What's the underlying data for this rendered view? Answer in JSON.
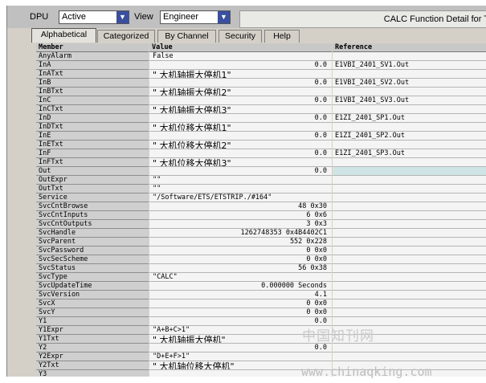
{
  "toolbar": {
    "dpu_label": "DPU",
    "dpu_value": "Active",
    "view_label": "View",
    "view_value": "Engineer",
    "window_title": "CALC Function Detail for T"
  },
  "tabs": [
    "Alphabetical",
    "Categorized",
    "By Channel",
    "Security",
    "Help"
  ],
  "grid": {
    "col_member": "Member",
    "col_value": "Value",
    "col_reference": "Reference"
  },
  "rows": [
    {
      "name": "AnyAlarm",
      "value": "False",
      "ref": ""
    },
    {
      "name": "InA",
      "value": "0.0",
      "ref": "E1VBI_2401_SV1.Out"
    },
    {
      "name": "InATxt",
      "value": "\" 大机轴振大停机1\"",
      "ref": ""
    },
    {
      "name": "InB",
      "value": "0.0",
      "ref": "E1VBI_2401_SV2.Out"
    },
    {
      "name": "InBTxt",
      "value": "\" 大机轴振大停机2\"",
      "ref": ""
    },
    {
      "name": "InC",
      "value": "0.0",
      "ref": "E1VBI_2401_SV3.Out"
    },
    {
      "name": "InCTxt",
      "value": "\" 大机轴振大停机3\"",
      "ref": ""
    },
    {
      "name": "InD",
      "value": "0.0",
      "ref": "E1ZI_2401_SP1.Out"
    },
    {
      "name": "InDTxt",
      "value": "\" 大机位移大停机1\"",
      "ref": ""
    },
    {
      "name": "InE",
      "value": "0.0",
      "ref": "E1ZI_2401_SP2.Out"
    },
    {
      "name": "InETxt",
      "value": "\" 大机位移大停机2\"",
      "ref": ""
    },
    {
      "name": "InF",
      "value": "0.0",
      "ref": "E1ZI_2401_SP3.Out"
    },
    {
      "name": "InFTxt",
      "value": "\" 大机位移大停机3\"",
      "ref": ""
    },
    {
      "name": "Out",
      "value": "0.0",
      "ref": ""
    },
    {
      "name": "OutExpr",
      "value": "\"\"",
      "ref": ""
    },
    {
      "name": "OutTxt",
      "value": "\"\"",
      "ref": ""
    },
    {
      "name": "Service",
      "value": "\"/Software/ETS/ETSTRIP./#164\"",
      "ref": ""
    },
    {
      "name": "SvcCntBrowse",
      "value": "48 0x30",
      "ref": ""
    },
    {
      "name": "SvcCntInputs",
      "value": "6 0x6",
      "ref": ""
    },
    {
      "name": "SvcCntOutputs",
      "value": "3 0x3",
      "ref": ""
    },
    {
      "name": "SvcHandle",
      "value": "1262748353 0x4B4402C1",
      "ref": ""
    },
    {
      "name": "SvcParent",
      "value": "552 0x228",
      "ref": ""
    },
    {
      "name": "SvcPassword",
      "value": "0 0x0",
      "ref": ""
    },
    {
      "name": "SvcSecScheme",
      "value": "0 0x0",
      "ref": ""
    },
    {
      "name": "SvcStatus",
      "value": "56 0x38",
      "ref": ""
    },
    {
      "name": "SvcType",
      "value": "\"CALC\"",
      "ref": ""
    },
    {
      "name": "SvcUpdateTime",
      "value": "0.000000 Seconds",
      "ref": ""
    },
    {
      "name": "SvcVersion",
      "value": "4.1",
      "ref": ""
    },
    {
      "name": "SvcX",
      "value": "0 0x0",
      "ref": ""
    },
    {
      "name": "SvcY",
      "value": "0 0x0",
      "ref": ""
    },
    {
      "name": "Y1",
      "value": "0.0",
      "ref": ""
    },
    {
      "name": "Y1Expr",
      "value": "\"A+B+C>1\"",
      "ref": ""
    },
    {
      "name": "Y1Txt",
      "value": "\" 大机轴振大停机\"",
      "ref": ""
    },
    {
      "name": "Y2",
      "value": "0.0",
      "ref": ""
    },
    {
      "name": "Y2Expr",
      "value": "\"D+E+F>1\"",
      "ref": ""
    },
    {
      "name": "Y2Txt",
      "value": "\" 大机轴位移大停机\"",
      "ref": ""
    },
    {
      "name": "Y3",
      "value": "",
      "ref": ""
    }
  ],
  "watermark": {
    "cn": "中国知刊网",
    "url": "www.chinaqking.com"
  }
}
